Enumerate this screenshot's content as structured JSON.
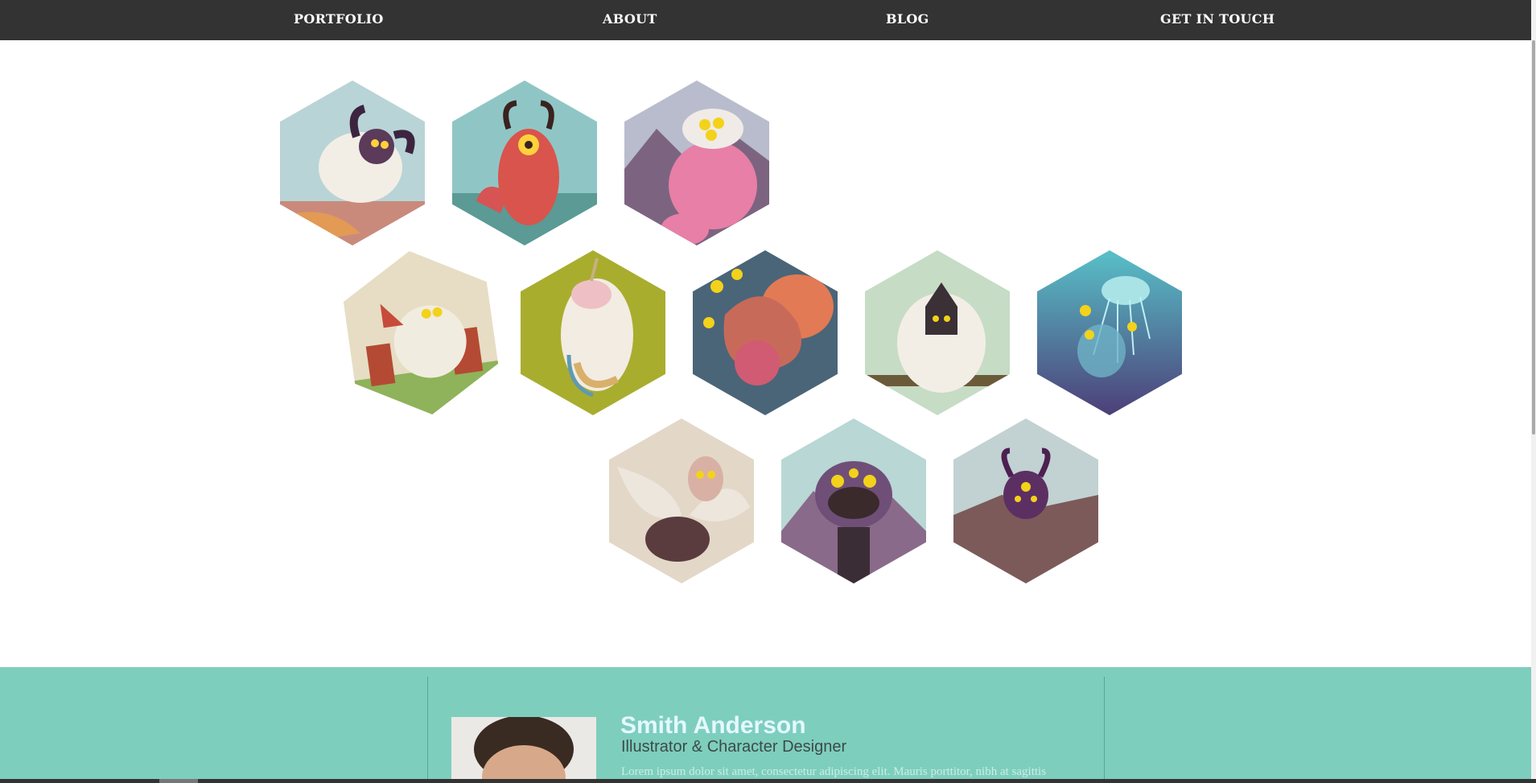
{
  "nav": {
    "items": [
      "PORTFOLIO",
      "ABOUT",
      "BLOG",
      "GET IN TOUCH"
    ]
  },
  "gallery": {
    "items": [
      {
        "subject": "woolly sheep monster"
      },
      {
        "subject": "red cyclops monster"
      },
      {
        "subject": "pink cow monster"
      },
      {
        "subject": "house creature"
      },
      {
        "subject": "sleeping unicorn creature"
      },
      {
        "subject": "octopus monster"
      },
      {
        "subject": "yeti creature"
      },
      {
        "subject": "jellyfish creature"
      },
      {
        "subject": "winged bird creature"
      },
      {
        "subject": "tiki mask monster"
      },
      {
        "subject": "purple horned monster"
      }
    ]
  },
  "profile": {
    "name": "Smith Anderson",
    "role": "Illustrator & Character Designer",
    "bio": "Lorem ipsum dolor sit amet, consectetur adipiscing elit. Mauris porttitor, nibh at sagittis"
  },
  "colors": {
    "nav_bg": "#333333",
    "band_bg": "#7ecebd",
    "name_color": "#e4f8ff"
  }
}
